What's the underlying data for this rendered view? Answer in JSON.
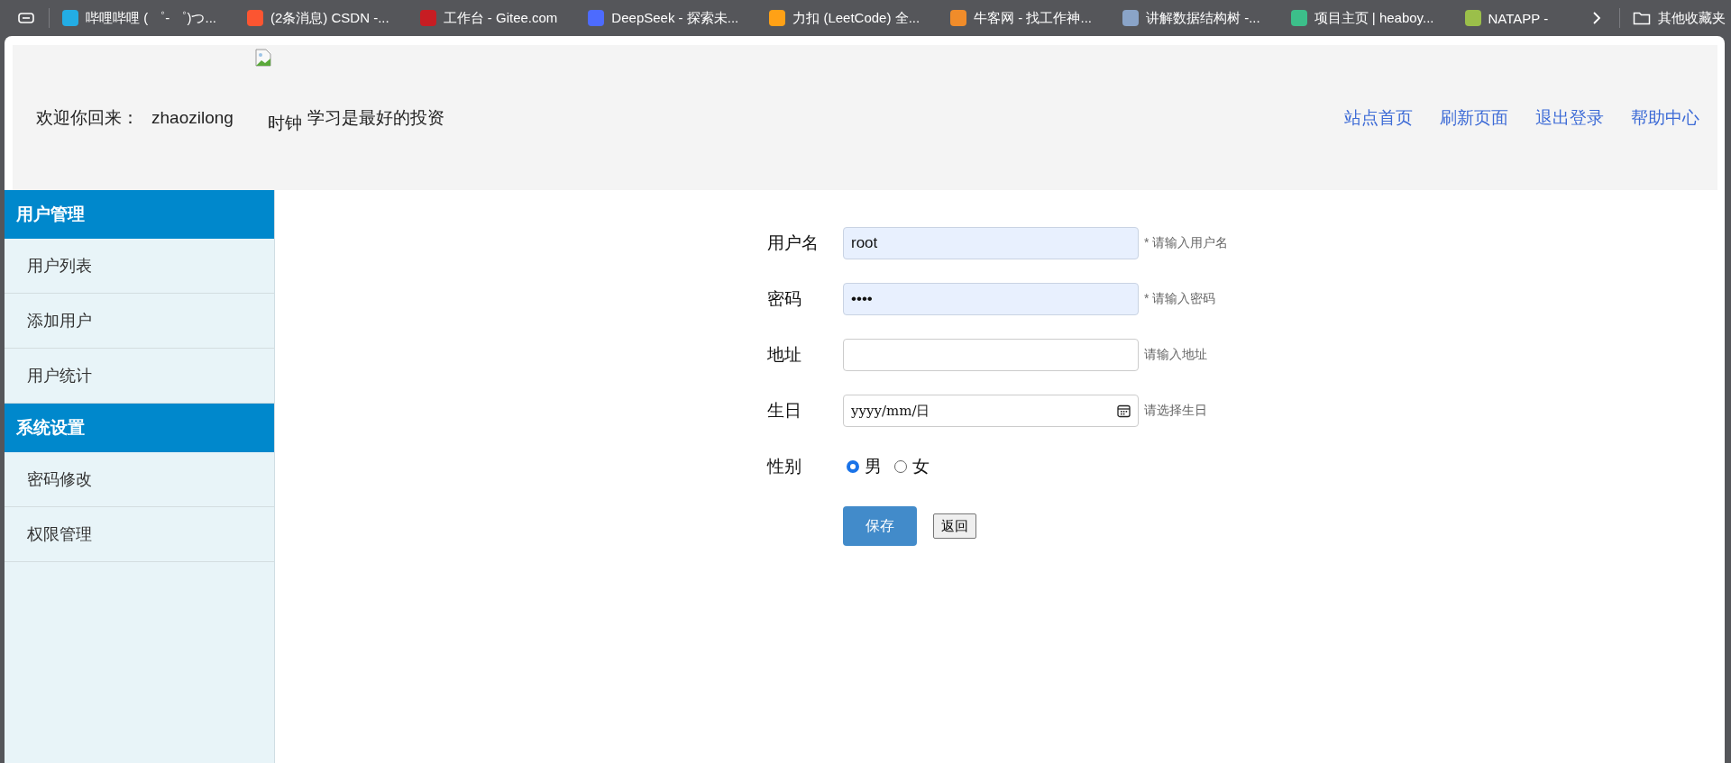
{
  "bookmarks_bar": {
    "items": [
      {
        "title": "哔哩哔哩 ( ゜- ゜)つ...",
        "color": "#23ade5"
      },
      {
        "title": "(2条消息) CSDN -...",
        "color": "#fc5531"
      },
      {
        "title": "工作台 - Gitee.com",
        "color": "#c71d23"
      },
      {
        "title": "DeepSeek - 探索未...",
        "color": "#4d6bfe"
      },
      {
        "title": "力扣 (LeetCode) 全...",
        "color": "#ffa116"
      },
      {
        "title": "牛客网 - 找工作神...",
        "color": "#f08c2a"
      },
      {
        "title": "讲解数据结构树 -...",
        "color": "#8aa4c8"
      },
      {
        "title": "项目主页 | heaboy...",
        "color": "#3cbf8a"
      },
      {
        "title": "NATAPP -",
        "color": "#9bbf4a"
      }
    ],
    "other_folder": "其他收藏夹"
  },
  "header": {
    "welcome": "欢迎你回来：",
    "username": "zhaozilong",
    "clock": "时钟",
    "motto": "学习是最好的投资",
    "nav": [
      "站点首页",
      "刷新页面",
      "退出登录",
      "帮助中心"
    ]
  },
  "sidebar": {
    "groups": [
      {
        "title": "用户管理",
        "items": [
          "用户列表",
          "添加用户",
          "用户统计"
        ]
      },
      {
        "title": "系统设置",
        "items": [
          "密码修改",
          "权限管理"
        ]
      }
    ]
  },
  "form": {
    "fields": [
      {
        "kind": "text",
        "label": "用户名",
        "value": "root",
        "autofilled": true,
        "hint": "* 请输入用户名"
      },
      {
        "kind": "text",
        "label": "密码",
        "value": "••••",
        "autofilled": true,
        "hint": "* 请输入密码"
      },
      {
        "kind": "text",
        "label": "地址",
        "autofilled": false,
        "hint": "请输入地址"
      },
      {
        "kind": "date",
        "label": "生日",
        "placeholder": "yyyy/mm/日",
        "hint": "请选择生日"
      },
      {
        "kind": "radio",
        "label": "性别",
        "options": [
          {
            "label": "男",
            "selected": true
          },
          {
            "label": "女",
            "selected": false
          }
        ]
      }
    ],
    "save_button": "保存",
    "back_button": "返回"
  }
}
